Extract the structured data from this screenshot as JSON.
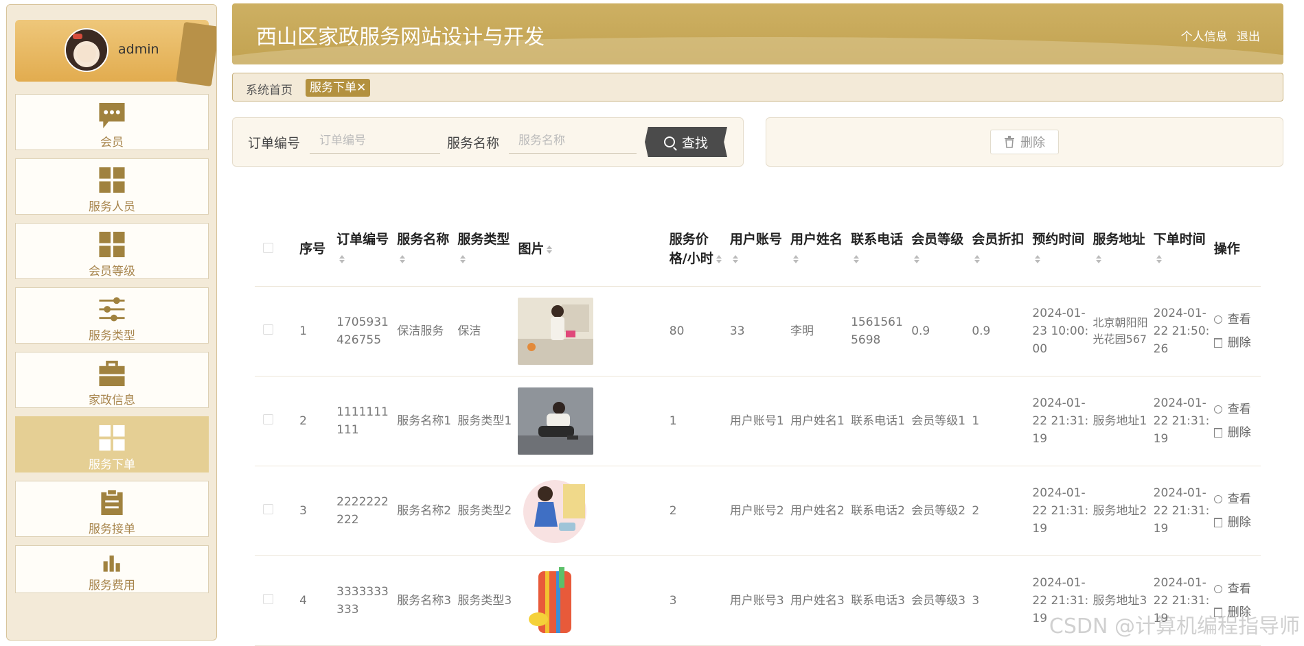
{
  "sidebar": {
    "username": "admin",
    "items": [
      {
        "label": "会员",
        "icon": "chat-bubble-icon"
      },
      {
        "label": "服务人员",
        "icon": "grid-icon"
      },
      {
        "label": "会员等级",
        "icon": "grid-icon"
      },
      {
        "label": "服务类型",
        "icon": "sliders-icon"
      },
      {
        "label": "家政信息",
        "icon": "briefcase-icon"
      },
      {
        "label": "服务下单",
        "icon": "grid-icon",
        "active": true
      },
      {
        "label": "服务接单",
        "icon": "clipboard-icon"
      },
      {
        "label": "服务费用",
        "icon": "bar-chart-icon"
      }
    ]
  },
  "header": {
    "title": "西山区家政服务网站设计与开发",
    "profile_link": "个人信息",
    "logout_link": "退出"
  },
  "breadcrumb": {
    "home": "系统首页",
    "current_tag": "服务下单✕"
  },
  "search": {
    "order_no_label": "订单编号",
    "order_no_placeholder": "订单编号",
    "service_name_label": "服务名称",
    "service_name_placeholder": "服务名称",
    "search_button": "查找"
  },
  "actions": {
    "delete_button": "删除"
  },
  "table": {
    "headers": [
      "序号",
      "订单编号",
      "服务名称",
      "服务类型",
      "图片",
      "服务价格/小时",
      "用户账号",
      "用户姓名",
      "联系电话",
      "会员等级",
      "会员折扣",
      "预约时间",
      "服务地址",
      "下单时间",
      "操作"
    ],
    "view_label": "查看",
    "delete_label": "删除",
    "rows": [
      {
        "index": "1",
        "order_no": "1705931426755",
        "service_name": "保洁服务",
        "service_type": "保洁",
        "price": "80",
        "account": "33",
        "user_name": "李明",
        "phone": "15615615698",
        "level": "0.9",
        "discount": "0.9",
        "appoint_time": "2024-01-23 10:00:00",
        "address": "北京朝阳阳光花园567",
        "order_time": "2024-01-22 21:50:26"
      },
      {
        "index": "2",
        "order_no": "1111111111",
        "service_name": "服务名称1",
        "service_type": "服务类型1",
        "price": "1",
        "account": "用户账号1",
        "user_name": "用户姓名1",
        "phone": "联系电话1",
        "level": "会员等级1",
        "discount": "1",
        "appoint_time": "2024-01-22 21:31:19",
        "address": "服务地址1",
        "order_time": "2024-01-22 21:31:19"
      },
      {
        "index": "3",
        "order_no": "2222222222",
        "service_name": "服务名称2",
        "service_type": "服务类型2",
        "price": "2",
        "account": "用户账号2",
        "user_name": "用户姓名2",
        "phone": "联系电话2",
        "level": "会员等级2",
        "discount": "2",
        "appoint_time": "2024-01-22 21:31:19",
        "address": "服务地址2",
        "order_time": "2024-01-22 21:31:19"
      },
      {
        "index": "4",
        "order_no": "3333333333",
        "service_name": "服务名称3",
        "service_type": "服务类型3",
        "price": "3",
        "account": "用户账号3",
        "user_name": "用户姓名3",
        "phone": "联系电话3",
        "level": "会员等级3",
        "discount": "3",
        "appoint_time": "2024-01-22 21:31:19",
        "address": "服务地址3",
        "order_time": "2024-01-22 21:31:19"
      }
    ]
  },
  "watermark": "CSDN @计算机编程指导师",
  "colors": {
    "accent": "#c2a250",
    "sidebar_active": "#e5cf94",
    "menu_label": "#a8864e"
  }
}
